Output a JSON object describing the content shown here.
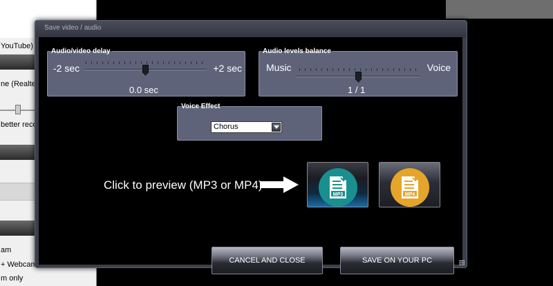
{
  "background_app": {
    "rows": [
      "YouTube)",
      "ne (Realtek",
      "better reco",
      "am",
      "+ Webcam",
      "m only"
    ]
  },
  "dialog": {
    "title": "Save video / audio",
    "delay_group": {
      "label": "Audio/video delay",
      "min_label": "-2 sec",
      "max_label": "+2 sec",
      "value_text": "0.0 sec",
      "position": 0.5
    },
    "balance_group": {
      "label": "Audio levels balance",
      "left_label": "Music",
      "right_label": "Voice",
      "value_text": "1 / 1",
      "position": 0.5
    },
    "voice_group": {
      "label": "Voice Effect",
      "selected": "Chorus"
    },
    "preview_text": "Click to preview (MP3 or MP4)",
    "mp3_button": {
      "icon_text": "MP3",
      "icon": "mp3-file-icon",
      "color": "#1a8f8f"
    },
    "mp4_button": {
      "icon_text": "MP4",
      "icon": "mp4-file-icon",
      "color": "#e5a52b"
    },
    "cancel_label": "CANCEL AND CLOSE",
    "save_label": "SAVE ON YOUR PC"
  }
}
